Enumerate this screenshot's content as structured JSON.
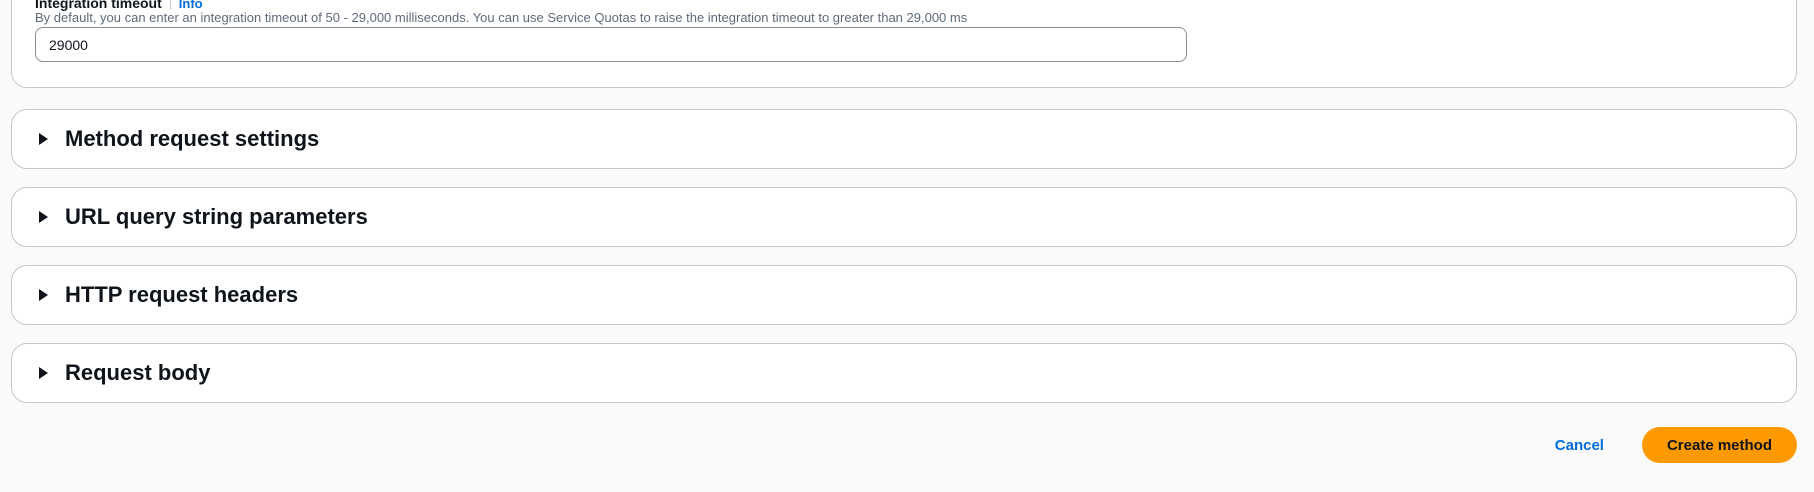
{
  "integration_timeout": {
    "label": "Integration timeout",
    "info_link": "Info",
    "description": "By default, you can enter an integration timeout of 50 - 29,000 milliseconds. You can use Service Quotas to raise the integration timeout to greater than 29,000 ms",
    "value": "29000"
  },
  "sections": [
    {
      "title": "Method request settings",
      "expanded": false
    },
    {
      "title": "URL query string parameters",
      "expanded": false
    },
    {
      "title": "HTTP request headers",
      "expanded": false
    },
    {
      "title": "Request body",
      "expanded": false
    }
  ],
  "actions": {
    "cancel_label": "Cancel",
    "create_label": "Create method"
  },
  "colors": {
    "primary_button": "#ff9900",
    "link": "#006ce0",
    "border": "#c6c6cd",
    "background": "#fafafa"
  }
}
